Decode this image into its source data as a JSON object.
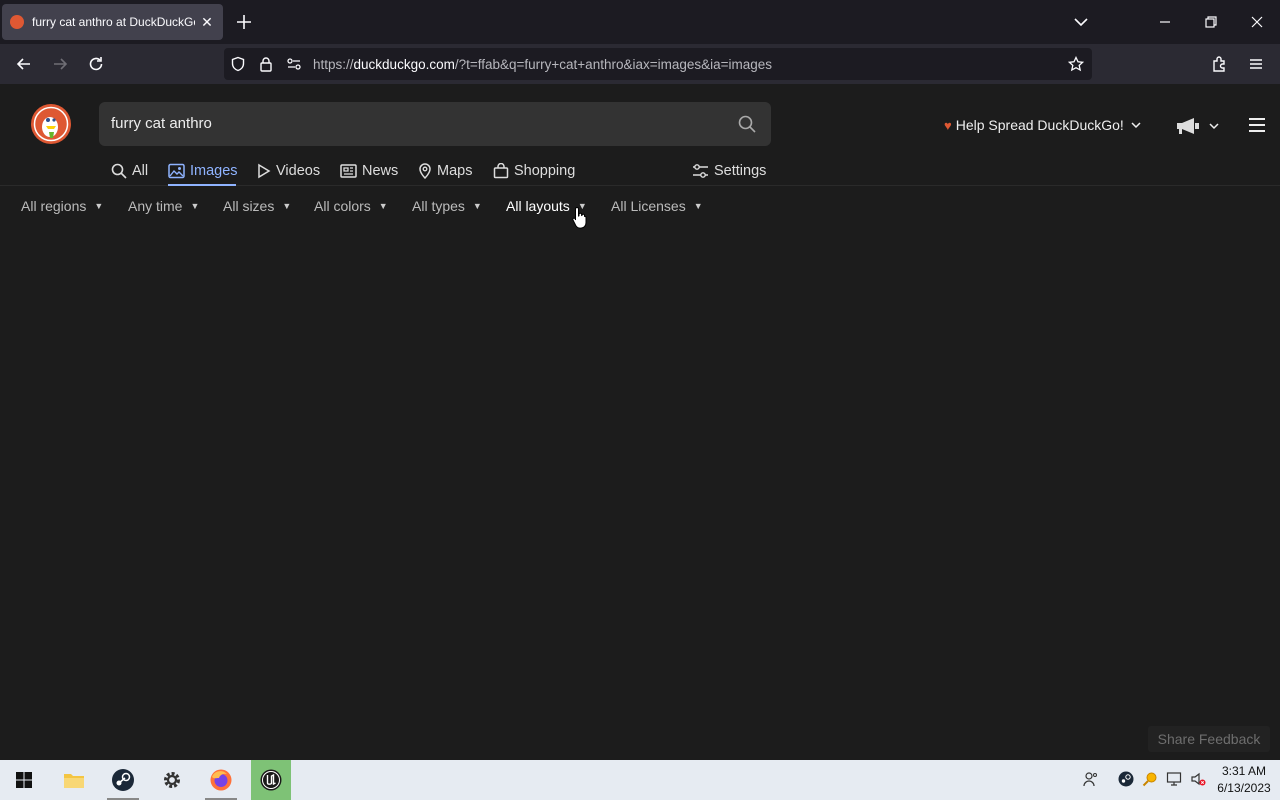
{
  "browser": {
    "tab_title": "furry cat anthro at DuckDuckGo",
    "url_prefix": "https://",
    "url_host": "duckduckgo.com",
    "url_rest": "/?t=ffab&q=furry+cat+anthro&iax=images&ia=images"
  },
  "ddg": {
    "search_query": "furry cat anthro",
    "spread_label": "Help Spread DuckDuckGo!",
    "tabs": [
      {
        "label": "All",
        "icon": "search-icon"
      },
      {
        "label": "Images",
        "icon": "image-icon",
        "active": true
      },
      {
        "label": "Videos",
        "icon": "play-icon"
      },
      {
        "label": "News",
        "icon": "newspaper-icon"
      },
      {
        "label": "Maps",
        "icon": "map-pin-icon"
      },
      {
        "label": "Shopping",
        "icon": "shopping-bag-icon"
      }
    ],
    "settings_label": "Settings",
    "filters": [
      {
        "label": "All regions"
      },
      {
        "label": "Any time"
      },
      {
        "label": "All sizes"
      },
      {
        "label": "All colors"
      },
      {
        "label": "All types"
      },
      {
        "label": "All layouts",
        "active": true
      },
      {
        "label": "All Licenses"
      }
    ],
    "feedback_label": "Share Feedback"
  },
  "taskbar": {
    "apps": [
      "windows-start-icon",
      "file-explorer-icon",
      "steam-icon",
      "settings-gear-icon",
      "firefox-icon",
      "unreal-engine-icon"
    ],
    "time": "3:31 AM",
    "date": "6/13/2023"
  },
  "colors": {
    "accent": "#8fb3ff",
    "ddg_orange": "#de5833",
    "page_bg": "#1c1c1c"
  }
}
